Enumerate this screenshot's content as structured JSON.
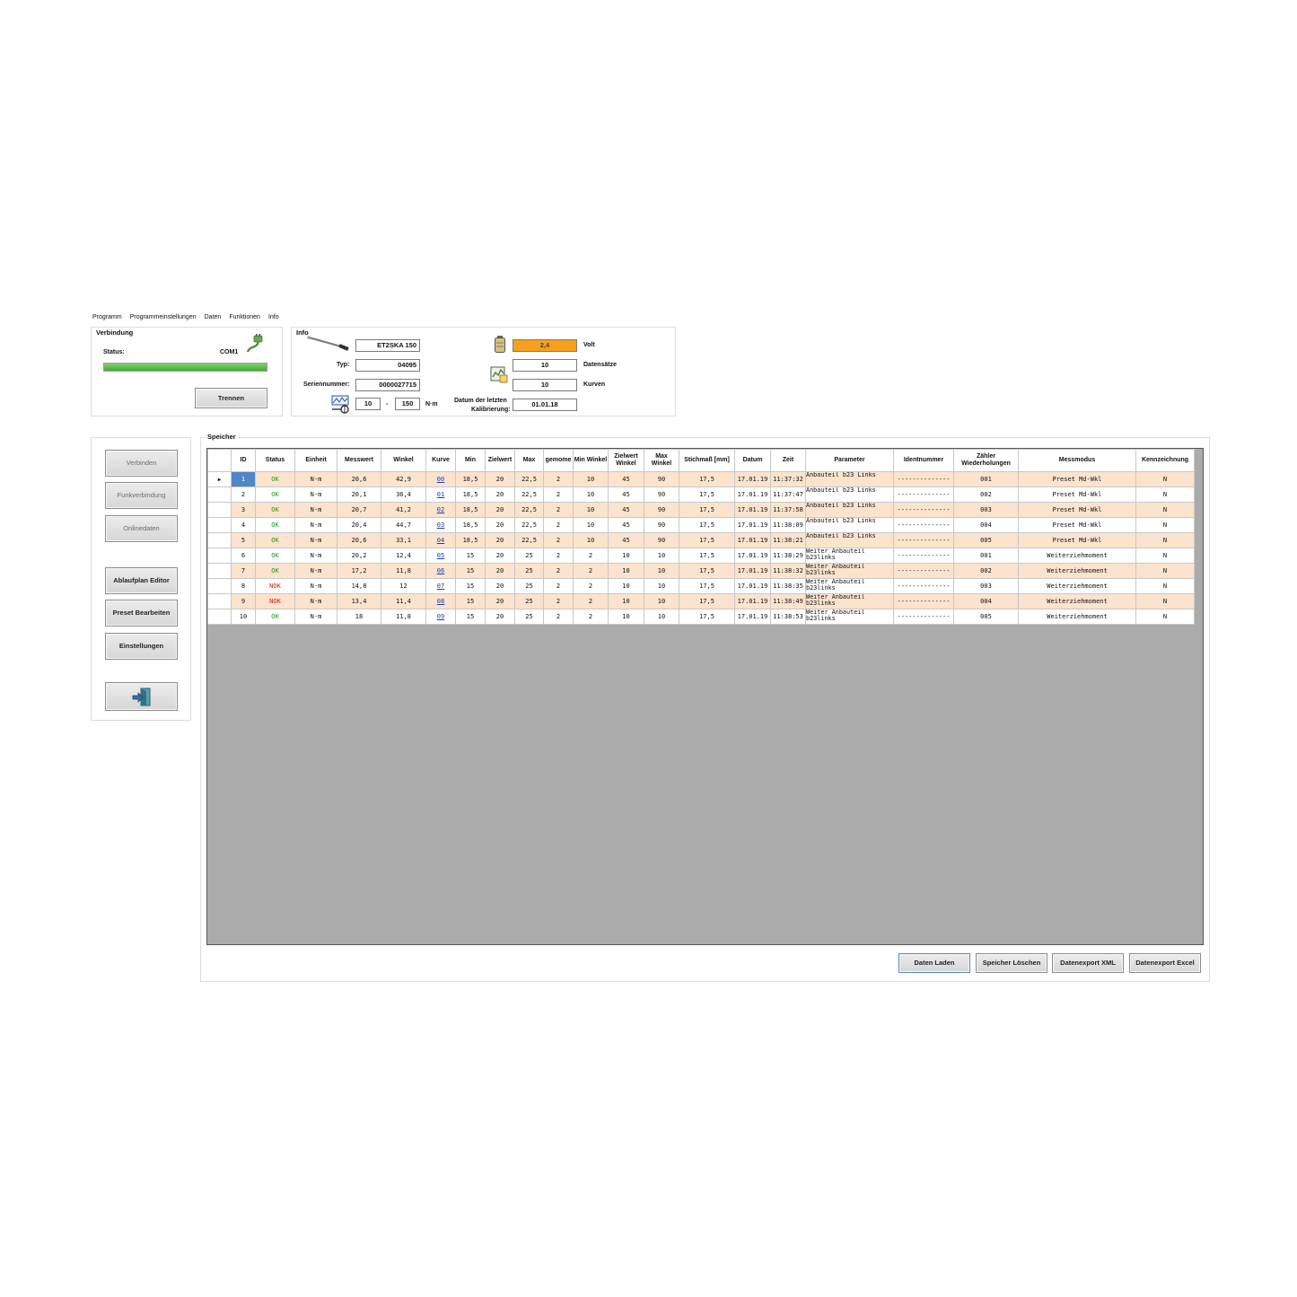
{
  "menu": [
    "Programm",
    "Programmeinstellungen",
    "Daten",
    "Funktionen",
    "Info"
  ],
  "verbindung": {
    "title": "Verbindung",
    "status_label": "Status:",
    "port": "COM1",
    "progress": 1.0,
    "disconnect_label": "Trennen"
  },
  "info": {
    "title": "Info",
    "device_name": "ET2SKA 150",
    "typ_label": "Typ:",
    "typ_value": "04095",
    "serial_label": "Seriennummer:",
    "serial_value": "0000027715",
    "range_min": "10",
    "range_sep": "-",
    "range_max": "150",
    "range_unit": "N·m",
    "volt_value": "2,4",
    "volt_label": "Volt",
    "datasets_value": "10",
    "datasets_label": "Datensätze",
    "curves_value": "10",
    "curves_label": "Kurven",
    "calib_label_1": "Datum der letzten",
    "calib_label_2": "Kalibrierung:",
    "calib_value": "01.01.18",
    "volt_color": "#f5a01e"
  },
  "side_buttons": {
    "connect": "Verbinden",
    "radio": "Funkverbindung",
    "online": "Onlinedaten",
    "editor": "Ablaufplan Editor",
    "preset": "Preset Bearbeiten",
    "settings": "Einstellungen"
  },
  "speicher": {
    "title": "Speicher",
    "columns": [
      "",
      "ID",
      "Status",
      "Einheit",
      "Messwert",
      "Winkel",
      "Kurve",
      "Min",
      "Zielwert",
      "Max",
      "gemome",
      "Min Winkel",
      "Zielwert Winkel",
      "Max Winkel",
      "Stichmaß [mm]",
      "Datum",
      "Zeit",
      "Parameter",
      "Identnummer",
      "Zähler Wiederholungen",
      "Messmodus",
      "Kennzeichnung"
    ],
    "rows": [
      [
        "1",
        "OK",
        "N·m",
        "20,6",
        "42,9",
        "00",
        "18,5",
        "20",
        "22,5",
        "2",
        "10",
        "45",
        "90",
        "17,5",
        "17.01.19",
        "11:37:32",
        "Anbauteil b23 Links",
        "--------------",
        "001",
        "Preset Md-Wkl",
        "N"
      ],
      [
        "2",
        "OK",
        "N·m",
        "20,1",
        "36,4",
        "01",
        "18,5",
        "20",
        "22,5",
        "2",
        "10",
        "45",
        "90",
        "17,5",
        "17.01.19",
        "11:37:47",
        "Anbauteil b23 Links",
        "--------------",
        "002",
        "Preset Md-Wkl",
        "N"
      ],
      [
        "3",
        "OK",
        "N·m",
        "20,7",
        "41,2",
        "02",
        "18,5",
        "20",
        "22,5",
        "2",
        "10",
        "45",
        "90",
        "17,5",
        "17.01.19",
        "11:37:58",
        "Anbauteil b23 Links",
        "--------------",
        "003",
        "Preset Md-Wkl",
        "N"
      ],
      [
        "4",
        "OK",
        "N·m",
        "20,4",
        "44,7",
        "03",
        "18,5",
        "20",
        "22,5",
        "2",
        "10",
        "45",
        "90",
        "17,5",
        "17.01.19",
        "11:38:09",
        "Anbauteil b23 Links",
        "--------------",
        "004",
        "Preset Md-Wkl",
        "N"
      ],
      [
        "5",
        "OK",
        "N·m",
        "20,6",
        "33,1",
        "04",
        "18,5",
        "20",
        "22,5",
        "2",
        "10",
        "45",
        "90",
        "17,5",
        "17.01.19",
        "11:38:21",
        "Anbauteil b23 Links",
        "--------------",
        "005",
        "Preset Md-Wkl",
        "N"
      ],
      [
        "6",
        "OK",
        "N·m",
        "20,2",
        "12,4",
        "05",
        "15",
        "20",
        "25",
        "2",
        "2",
        "10",
        "10",
        "17,5",
        "17.01.19",
        "11:38:29",
        "Weiter Anbauteil b23links",
        "--------------",
        "001",
        "Weiterziehmoment",
        "N"
      ],
      [
        "7",
        "OK",
        "N·m",
        "17,2",
        "11,8",
        "06",
        "15",
        "20",
        "25",
        "2",
        "2",
        "10",
        "10",
        "17,5",
        "17.01.19",
        "11:38:32",
        "Weiter Anbauteil b23links",
        "--------------",
        "002",
        "Weiterziehmoment",
        "N"
      ],
      [
        "8",
        "NOK",
        "N·m",
        "14,8",
        "12",
        "07",
        "15",
        "20",
        "25",
        "2",
        "2",
        "10",
        "10",
        "17,5",
        "17.01.19",
        "11:38:35",
        "Weiter Anbauteil b23links",
        "--------------",
        "003",
        "Weiterziehmoment",
        "N"
      ],
      [
        "9",
        "NOK",
        "N·m",
        "13,4",
        "11,4",
        "08",
        "15",
        "20",
        "25",
        "2",
        "2",
        "10",
        "10",
        "17,5",
        "17.01.19",
        "11:38:49",
        "Weiter Anbauteil b23links",
        "--------------",
        "004",
        "Weiterziehmoment",
        "N"
      ],
      [
        "10",
        "OK",
        "N·m",
        "18",
        "11,8",
        "09",
        "15",
        "20",
        "25",
        "2",
        "2",
        "10",
        "10",
        "17,5",
        "17.01.19",
        "11:38:53",
        "Weiter Anbauteil b23links",
        "--------------",
        "005",
        "Weiterziehmoment",
        "N"
      ]
    ]
  },
  "bottom_buttons": {
    "load": "Daten Laden",
    "clear": "Speicher Löschen",
    "xml": "Datenexport XML",
    "excel": "Datenexport Excel"
  },
  "icons": {
    "plug": "plug-icon",
    "probe": "torque-probe-icon",
    "battery": "battery-icon",
    "records": "records-icon",
    "range": "range-icon",
    "exit": "exit-icon"
  }
}
